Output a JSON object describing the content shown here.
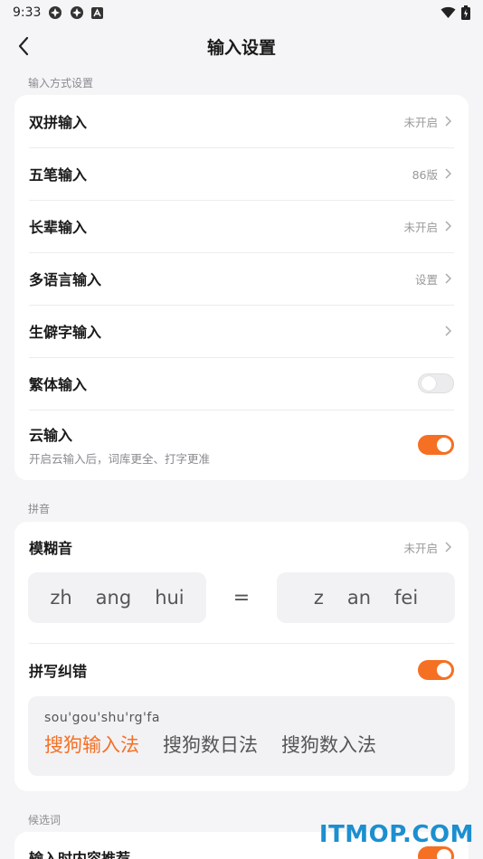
{
  "status_bar": {
    "time": "9:33"
  },
  "nav": {
    "title": "输入设置"
  },
  "sections": {
    "input_methods": "输入方式设置",
    "pinyin": "拼音",
    "candidates": "候选词"
  },
  "input_rows": [
    {
      "label": "双拼输入",
      "value": "未开启"
    },
    {
      "label": "五笔输入",
      "value": "86版"
    },
    {
      "label": "长辈输入",
      "value": "未开启"
    },
    {
      "label": "多语言输入",
      "value": "设置"
    },
    {
      "label": "生僻字输入",
      "value": ""
    }
  ],
  "traditional": {
    "label": "繁体输入",
    "enabled": false
  },
  "cloud": {
    "label": "云输入",
    "subtitle": "开启云输入后，词库更全、打字更准",
    "enabled": true
  },
  "fuzzy": {
    "label": "模糊音",
    "value": "未开启",
    "left": [
      "zh",
      "ang",
      "hui"
    ],
    "equals": "=",
    "right": [
      "z",
      "an",
      "fei"
    ]
  },
  "spell_correct": {
    "label": "拼写纠错",
    "enabled": true,
    "pinyin": "sou'gou'shu'rg'fa",
    "candidates": [
      "搜狗输入法",
      "搜狗数日法",
      "搜狗数入法"
    ]
  },
  "candidate_row": {
    "label": "输入时内容推荐",
    "enabled": true
  },
  "watermark": "ITMOP.COM",
  "colors": {
    "accent": "#f57023",
    "background": "#f5f5f7",
    "card": "#ffffff"
  },
  "icons": [
    "chevron-left-icon",
    "chevron-right-icon",
    "wifi-icon",
    "battery-icon"
  ]
}
